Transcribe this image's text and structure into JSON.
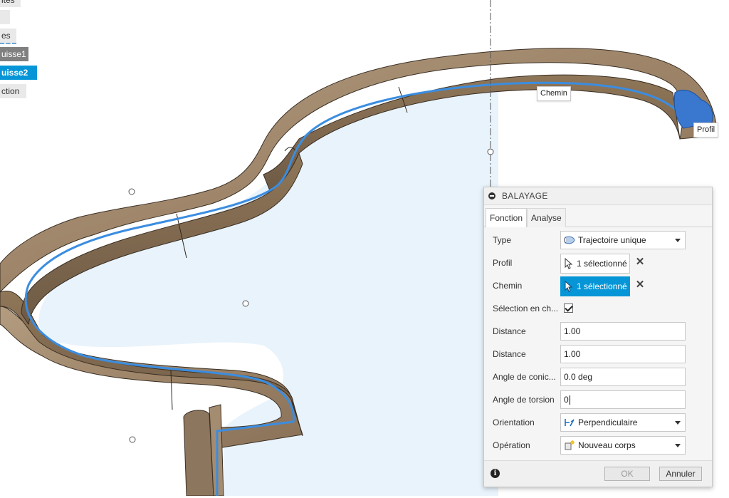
{
  "browser": {
    "items": [
      {
        "label": "ites",
        "style": "plain"
      },
      {
        "label": "",
        "style": "plain"
      },
      {
        "label": "es",
        "style": "hatched"
      },
      {
        "label": "uisse1",
        "style": "dark"
      },
      {
        "label": "uisse2",
        "style": "blue"
      },
      {
        "label": "ction",
        "style": "plain"
      }
    ]
  },
  "viewport": {
    "labels": {
      "path": "Chemin",
      "profile": "Profil"
    }
  },
  "dialog": {
    "title": "BALAYAGE",
    "tabs": [
      {
        "label": "Fonction",
        "active": true
      },
      {
        "label": "Analyse",
        "active": false
      }
    ],
    "rows": {
      "type": {
        "label": "Type",
        "value": "Trajectoire unique",
        "icon": "trajectory-icon"
      },
      "profile": {
        "label": "Profil",
        "value": "1 sélectionné"
      },
      "path": {
        "label": "Chemin",
        "value": "1 sélectionné"
      },
      "chain": {
        "label": "Sélection en ch...",
        "checked": true
      },
      "distance1": {
        "label": "Distance",
        "value": "1.00"
      },
      "distance2": {
        "label": "Distance",
        "value": "1.00"
      },
      "taper": {
        "label": "Angle de conic...",
        "value": "0.0 deg"
      },
      "twist": {
        "label": "Angle de torsion",
        "value": "0"
      },
      "orientation": {
        "label": "Orientation",
        "value": "Perpendiculaire",
        "icon": "perpendicular-icon"
      },
      "operation": {
        "label": "Opération",
        "value": "Nouveau corps",
        "icon": "new-body-icon"
      }
    },
    "buttons": {
      "ok": "OK",
      "cancel": "Annuler"
    }
  },
  "colors": {
    "accent": "#0696d7",
    "path_line": "#3b8de0",
    "wood": "#9b8369",
    "sketch_fill": "#e9f3fb"
  }
}
